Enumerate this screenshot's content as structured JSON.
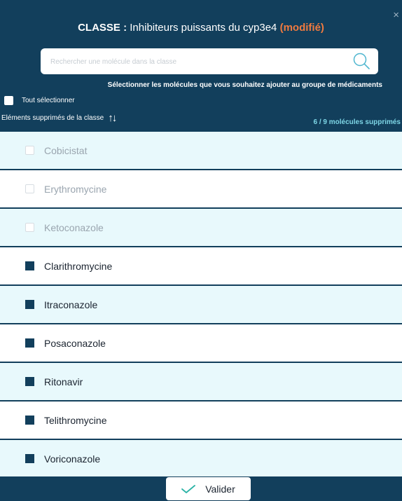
{
  "dialog": {
    "close_glyph": "×",
    "title_label": "CLASSE :",
    "title_name": "Inhibiteurs puissants du cyp3e4",
    "title_modified": "(modifié)",
    "search_placeholder": "Rechercher une molécule dans la classe",
    "instruction": "Sélectionner les molécules que vous souhaitez ajouter au groupe de médicaments",
    "select_all_label": "Tout sélectionner",
    "removed_label": "Eléments supprimés de la classe",
    "sort_glyph": "↑↓",
    "removed_count": "6 / 9 molécules supprimés",
    "validate_label": "Valider"
  },
  "molecules": [
    {
      "name": "Cobicistat",
      "state": "removed"
    },
    {
      "name": "Erythromycine",
      "state": "removed"
    },
    {
      "name": "Ketoconazole",
      "state": "removed"
    },
    {
      "name": "Clarithromycine",
      "state": "checked"
    },
    {
      "name": "Itraconazole",
      "state": "checked"
    },
    {
      "name": "Posaconazole",
      "state": "checked"
    },
    {
      "name": "Ritonavir",
      "state": "checked"
    },
    {
      "name": "Telithromycine",
      "state": "checked"
    },
    {
      "name": "Voriconazole",
      "state": "checked"
    }
  ],
  "icons": {
    "search": "magnifier-icon",
    "sort": "sort-arrows-icon",
    "validate": "checkmark-icon",
    "close": "close-icon"
  },
  "colors": {
    "header_bg": "#123f5c",
    "modified_accent": "#f07a3f",
    "count_accent": "#7ed6e6",
    "row_tint": "#e8f9fc",
    "check_accent": "#2bb3a6"
  }
}
